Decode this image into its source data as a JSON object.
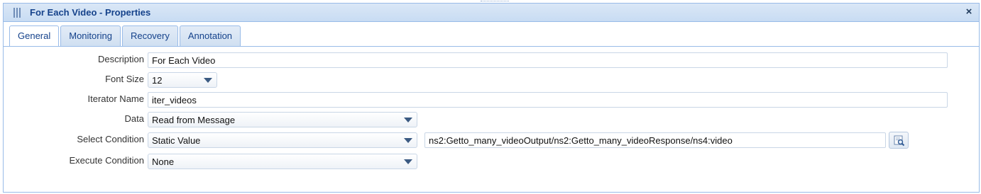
{
  "window": {
    "title": "For Each Video - Properties",
    "close_label": "×"
  },
  "tabs": [
    {
      "label": "General",
      "active": true
    },
    {
      "label": "Monitoring",
      "active": false
    },
    {
      "label": "Recovery",
      "active": false
    },
    {
      "label": "Annotation",
      "active": false
    }
  ],
  "form": {
    "description": {
      "label": "Description",
      "value": "For Each Video"
    },
    "font_size": {
      "label": "Font Size",
      "value": "12"
    },
    "iterator_name": {
      "label": "Iterator Name",
      "value": "iter_videos"
    },
    "data": {
      "label": "Data",
      "value": "Read from Message"
    },
    "select_condition": {
      "label": "Select Condition",
      "value": "Static Value",
      "expression": "ns2:Getto_many_videoOutput/ns2:Getto_many_videoResponse/ns4:video"
    },
    "execute_condition": {
      "label": "Execute Condition",
      "value": "None"
    }
  },
  "colors": {
    "accent": "#15428b",
    "border": "#99bbe8",
    "titlebar": "#dae7f6"
  },
  "icons": {
    "drag": "drag-handle-icon",
    "close": "close-icon",
    "dropdown": "chevron-down-icon",
    "picker": "expression-picker-icon"
  }
}
